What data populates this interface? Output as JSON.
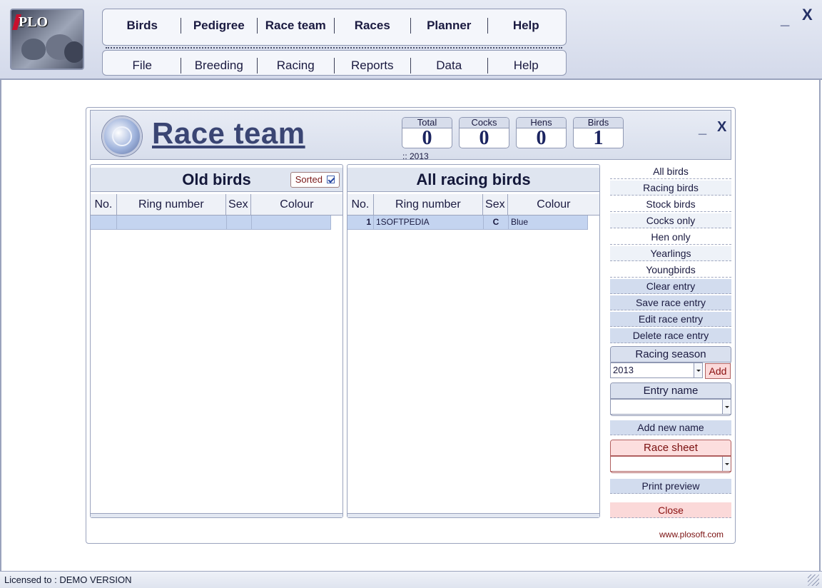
{
  "app": {
    "logo_text": "PLO",
    "menu_top": [
      "Birds",
      "Pedigree",
      "Race team",
      "Races",
      "Planner",
      "Help"
    ],
    "menu_bottom": [
      "File",
      "Breeding",
      "Racing",
      "Reports",
      "Data",
      "Help"
    ],
    "minimize_label": "_",
    "close_label": "X"
  },
  "panel": {
    "title": "Race team",
    "minimize_label": "_",
    "close_label": "X",
    "stats": [
      {
        "label": "Total",
        "value": "0"
      },
      {
        "label": "Cocks",
        "value": "0"
      },
      {
        "label": "Hens",
        "value": "0"
      },
      {
        "label": "Birds",
        "value": "1"
      }
    ],
    "season_tag": ":: 2013",
    "old_birds": {
      "title": "Old birds",
      "sorted_label": "Sorted",
      "sorted_checked": true,
      "columns": [
        "No.",
        "Ring number",
        "Sex",
        "Colour"
      ],
      "rows": [
        {
          "no": "",
          "ring": "",
          "sex": "",
          "colour": ""
        }
      ]
    },
    "all_birds": {
      "title": "All racing birds",
      "columns": [
        "No.",
        "Ring number",
        "Sex",
        "Colour"
      ],
      "rows": [
        {
          "no": "1",
          "ring": "1SOFTPEDIA",
          "sex": "C",
          "colour": "Blue"
        }
      ]
    },
    "side_buttons": [
      "All birds",
      "Racing birds",
      "Stock birds",
      "Cocks only",
      "Hen only",
      "Yearlings",
      "Youngbirds",
      "Clear entry",
      "Save race entry",
      "Edit race entry",
      "Delete race entry"
    ],
    "racing_season": {
      "label": "Racing season",
      "value": "2013",
      "add_label": "Add"
    },
    "entry_name": {
      "label": "Entry name",
      "value": ""
    },
    "add_new_name": "Add new name",
    "race_sheet": {
      "label": "Race sheet",
      "value": ""
    },
    "print_preview": "Print preview",
    "close": "Close",
    "website": "www.plosoft.com"
  },
  "status": {
    "text": "Licensed to : DEMO VERSION"
  },
  "colors": {
    "accent": "#3a4573",
    "header_bg": "#d3d9ea",
    "selection": "#c4d4f0",
    "danger": "#fbd9d9"
  }
}
